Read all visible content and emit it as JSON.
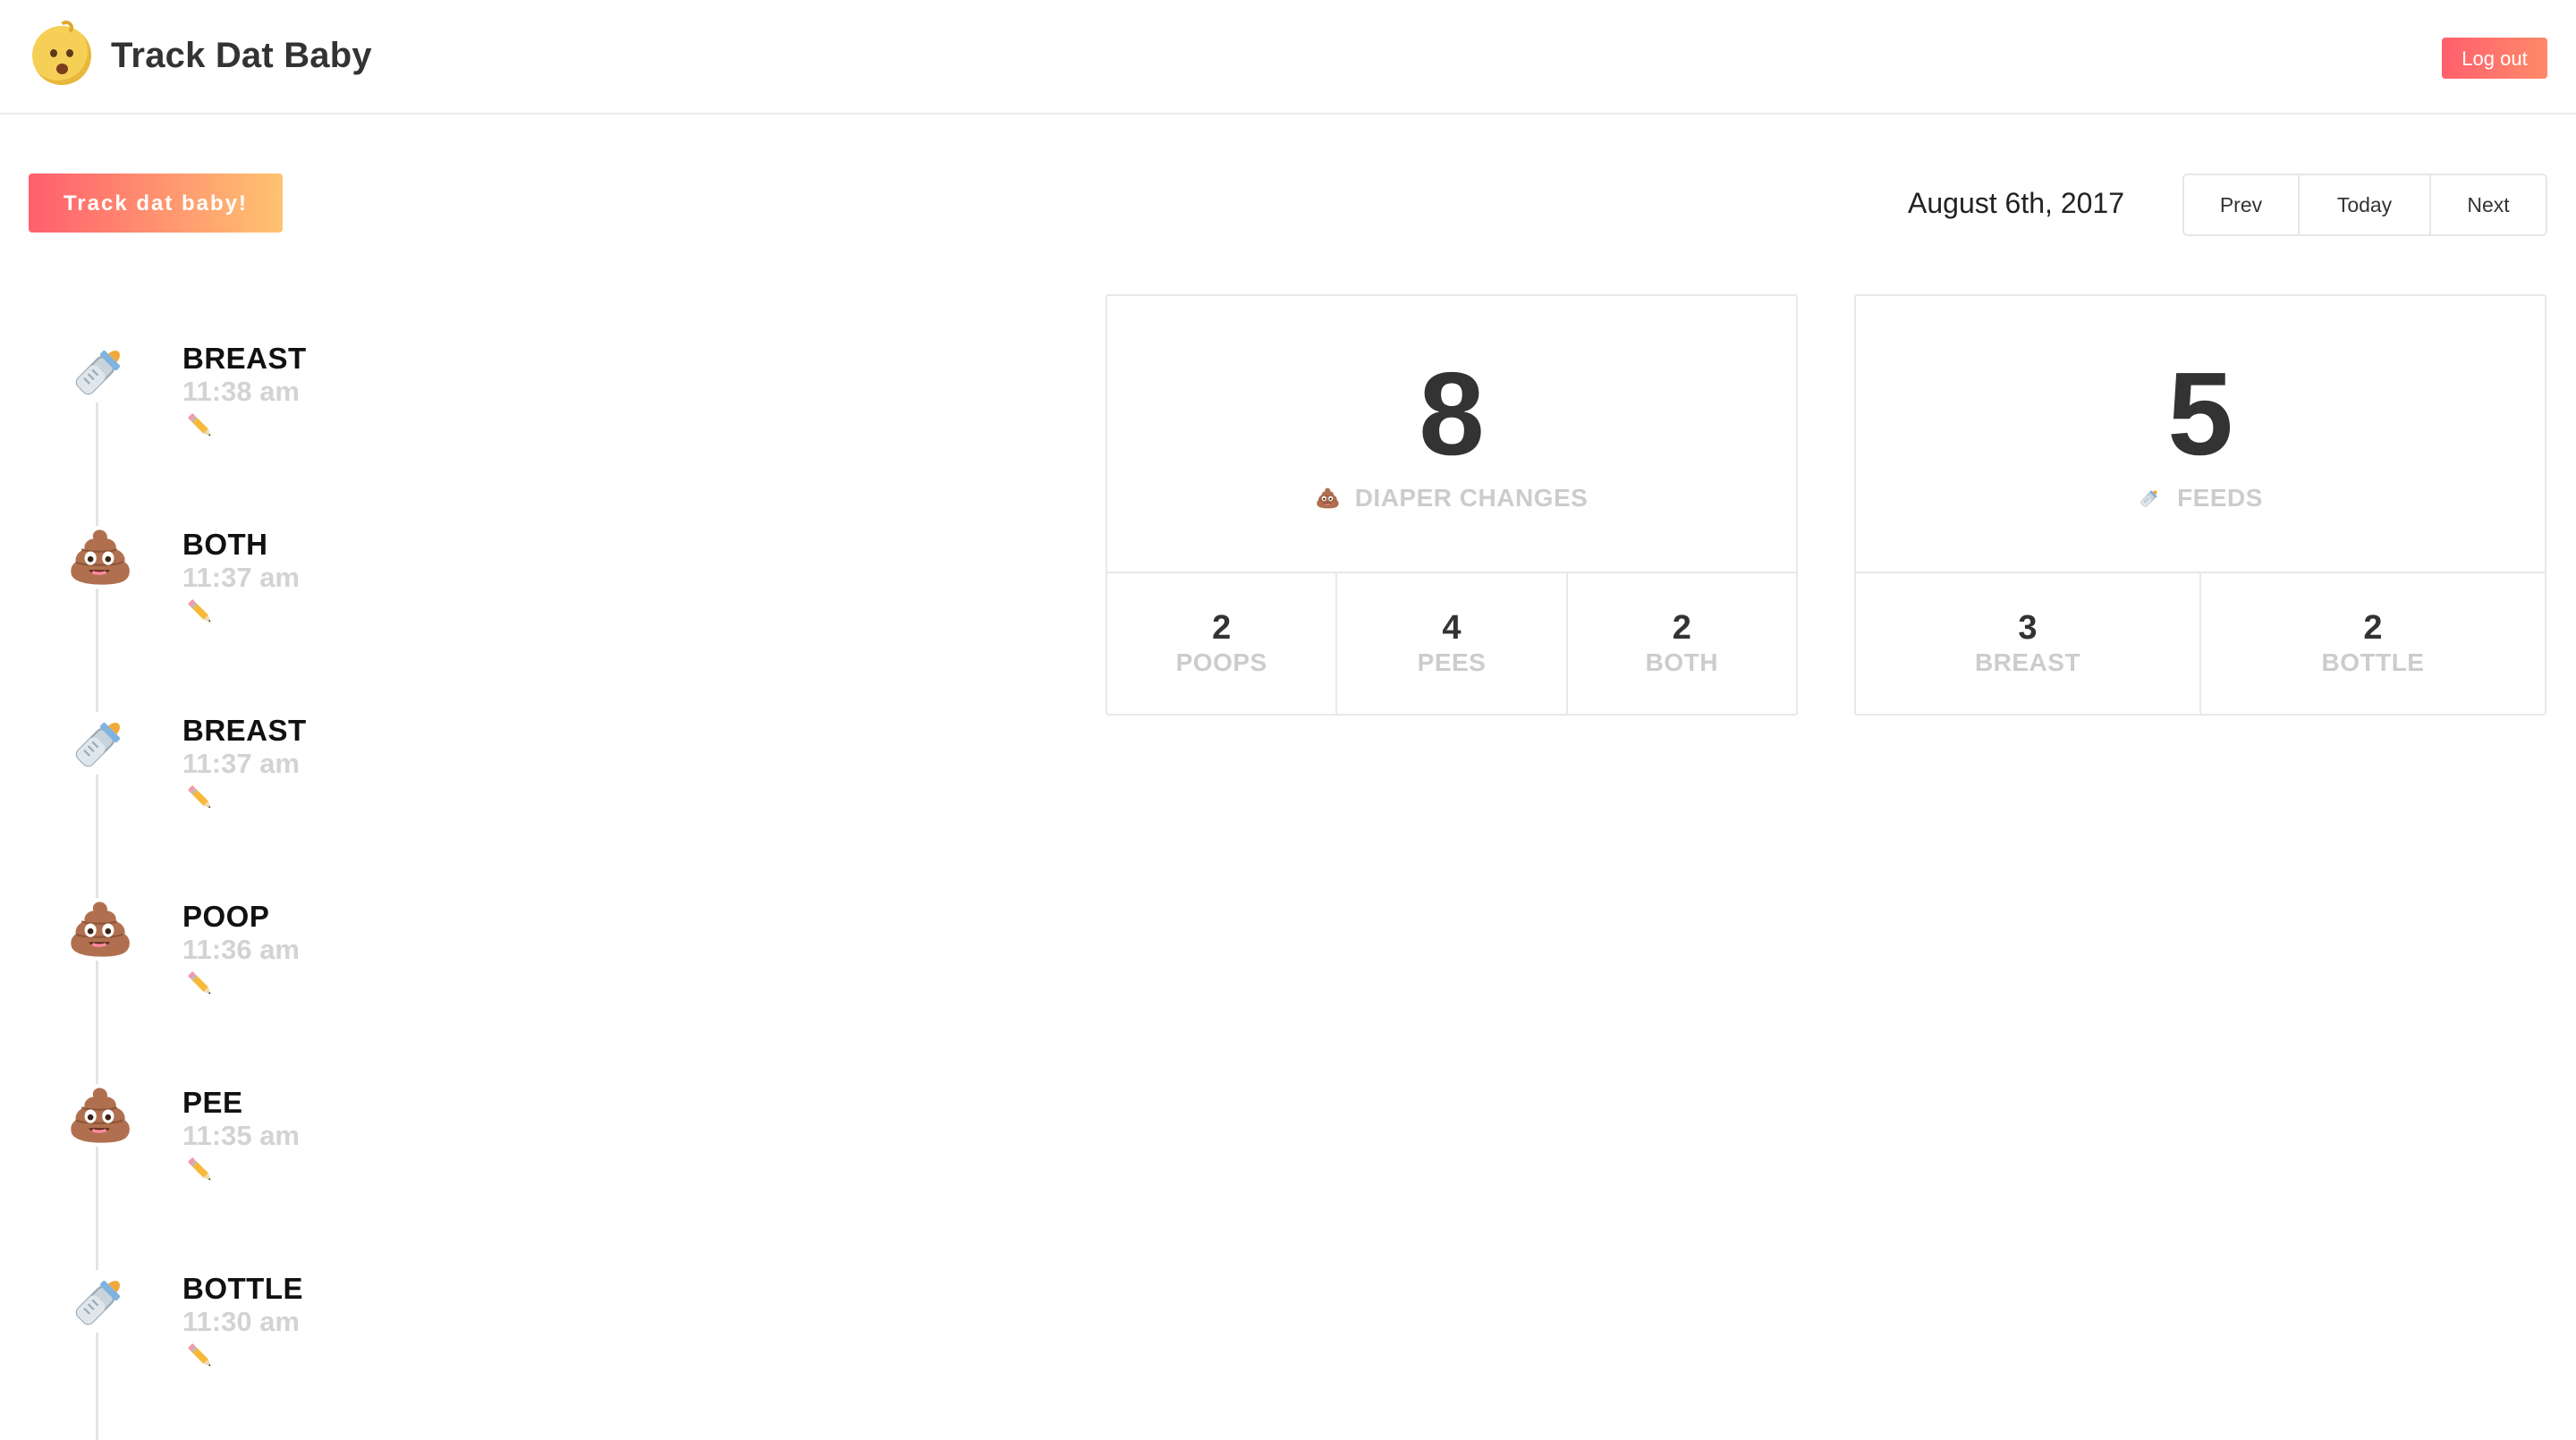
{
  "header": {
    "title": "Track Dat Baby",
    "logo_icon": "baby-face-icon",
    "logout_label": "Log out"
  },
  "toolbar": {
    "track_label": "Track dat baby!",
    "current_date": "August 6th, 2017",
    "prev_label": "Prev",
    "today_label": "Today",
    "next_label": "Next"
  },
  "timeline": {
    "events": [
      {
        "type": "BREAST",
        "time": "11:38 am",
        "icon": "baby-bottle-icon"
      },
      {
        "type": "BOTH",
        "time": "11:37 am",
        "icon": "poop-icon"
      },
      {
        "type": "BREAST",
        "time": "11:37 am",
        "icon": "baby-bottle-icon"
      },
      {
        "type": "POOP",
        "time": "11:36 am",
        "icon": "poop-icon"
      },
      {
        "type": "PEE",
        "time": "11:35 am",
        "icon": "poop-icon"
      },
      {
        "type": "BOTTLE",
        "time": "11:30 am",
        "icon": "baby-bottle-icon"
      }
    ],
    "edit_icon": "pencil-icon"
  },
  "stats": {
    "diaper": {
      "count": "8",
      "label": "DIAPER CHANGES",
      "icon": "poop-icon",
      "breakdown": [
        {
          "count": "2",
          "label": "POOPS"
        },
        {
          "count": "4",
          "label": "PEES"
        },
        {
          "count": "2",
          "label": "BOTH"
        }
      ]
    },
    "feeds": {
      "count": "5",
      "label": "FEEDS",
      "icon": "baby-bottle-icon",
      "breakdown": [
        {
          "count": "3",
          "label": "BREAST"
        },
        {
          "count": "2",
          "label": "BOTTLE"
        }
      ]
    }
  },
  "colors": {
    "accent_start": "#ff5f6d",
    "accent_end": "#ffc371",
    "muted_text": "#cccccc",
    "border": "#e8e8e8"
  }
}
